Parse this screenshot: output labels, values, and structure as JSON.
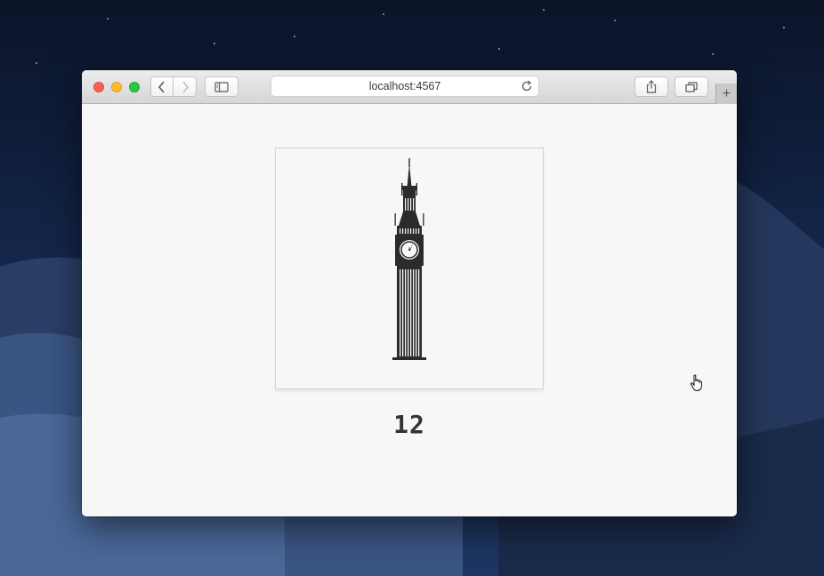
{
  "browser": {
    "address": "localhost:4567",
    "icons": {
      "back": "chevron-left-icon",
      "forward": "chevron-right-icon",
      "sidebar": "sidebar-icon",
      "reload": "reload-icon",
      "share": "share-icon",
      "tabs": "tabs-overview-icon",
      "new_tab": "plus-icon"
    },
    "new_tab_label": "+"
  },
  "main": {
    "image": {
      "subject": "big-ben-icon",
      "color": "#2b2b2b"
    },
    "counter": "12"
  },
  "colors": {
    "page_background": "#f7f7f7",
    "counter_text": "#333333",
    "traffic_red": "#fc5f57",
    "traffic_yellow": "#fdbc2e",
    "traffic_green": "#28c940"
  }
}
